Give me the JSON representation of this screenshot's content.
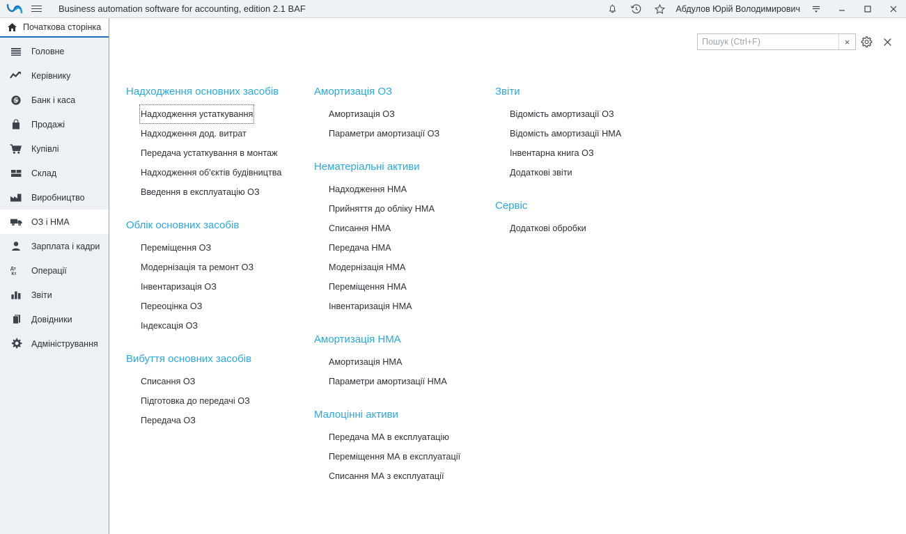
{
  "titlebar": {
    "logo_icon": "ba-logo-icon",
    "menu_icon": "hamburger-menu-icon",
    "app_title": "Business automation software for accounting, edition 2.1 BAF",
    "notifications_icon": "bell-icon",
    "history_icon": "history-clock-icon",
    "favorites_icon": "star-icon",
    "user_name": "Абдулов Юрій Володимирович",
    "filter_icon": "filter-lines-icon",
    "minimize_icon": "minimize-icon",
    "maximize_icon": "maximize-icon",
    "close_icon": "close-icon"
  },
  "sidebar": {
    "home_tab": {
      "label": "Початкова сторінка",
      "icon": "home-icon"
    },
    "items": [
      {
        "label": "Головне",
        "icon": "list-lines-icon",
        "active": false
      },
      {
        "label": "Керівнику",
        "icon": "trend-arrow-icon",
        "active": false
      },
      {
        "label": "Банк і каса",
        "icon": "currency-circle-icon",
        "active": false
      },
      {
        "label": "Продажі",
        "icon": "shopping-bag-icon",
        "active": false
      },
      {
        "label": "Купівлі",
        "icon": "shopping-cart-icon",
        "active": false
      },
      {
        "label": "Склад",
        "icon": "grid-blocks-icon",
        "active": false
      },
      {
        "label": "Виробництво",
        "icon": "factory-icon",
        "active": false
      },
      {
        "label": "ОЗ і НМА",
        "icon": "truck-icon",
        "active": true
      },
      {
        "label": "Зарплата і кадри",
        "icon": "person-icon",
        "active": false
      },
      {
        "label": "Операції",
        "icon": "debit-credit-icon",
        "active": false
      },
      {
        "label": "Звіти",
        "icon": "bar-chart-icon",
        "active": false
      },
      {
        "label": "Довідники",
        "icon": "books-stack-icon",
        "active": false
      },
      {
        "label": "Адміністрування",
        "icon": "gear-icon",
        "active": false
      }
    ]
  },
  "search": {
    "value": "",
    "placeholder": "Пошук (Ctrl+F)",
    "clear_label": "×",
    "settings_icon": "gear-icon",
    "close_icon": "close-icon"
  },
  "columns": [
    {
      "groups": [
        {
          "title": "Надходження основних засобів",
          "items": [
            {
              "label": "Надходження устаткування",
              "focused": true
            },
            {
              "label": "Надходження дод. витрат",
              "focused": false
            },
            {
              "label": "Передача устаткування в монтаж",
              "focused": false
            },
            {
              "label": "Надходження об'єктів будівництва",
              "focused": false
            },
            {
              "label": "Введення в експлуатацію ОЗ",
              "focused": false
            }
          ]
        },
        {
          "title": "Облік основних засобів",
          "items": [
            {
              "label": "Переміщення ОЗ",
              "focused": false
            },
            {
              "label": "Модернізація та ремонт ОЗ",
              "focused": false
            },
            {
              "label": "Інвентаризація ОЗ",
              "focused": false
            },
            {
              "label": "Переоцінка ОЗ",
              "focused": false
            },
            {
              "label": "Індексація ОЗ",
              "focused": false
            }
          ]
        },
        {
          "title": "Вибуття основних засобів",
          "items": [
            {
              "label": "Списання ОЗ",
              "focused": false
            },
            {
              "label": "Підготовка до передачі ОЗ",
              "focused": false
            },
            {
              "label": "Передача ОЗ",
              "focused": false
            }
          ]
        }
      ]
    },
    {
      "groups": [
        {
          "title": "Амортизація ОЗ",
          "items": [
            {
              "label": "Амортизація ОЗ",
              "focused": false
            },
            {
              "label": "Параметри амортизації ОЗ",
              "focused": false
            }
          ]
        },
        {
          "title": "Нематеріальні активи",
          "items": [
            {
              "label": "Надходження НМА",
              "focused": false
            },
            {
              "label": "Прийняття до обліку НМА",
              "focused": false
            },
            {
              "label": "Списання НМА",
              "focused": false
            },
            {
              "label": "Передача НМА",
              "focused": false
            },
            {
              "label": "Модернізація НМА",
              "focused": false
            },
            {
              "label": "Переміщення НМА",
              "focused": false
            },
            {
              "label": "Інвентаризація НМА",
              "focused": false
            }
          ]
        },
        {
          "title": "Амортизація НМА",
          "items": [
            {
              "label": "Амортизація НМА",
              "focused": false
            },
            {
              "label": "Параметри амортизації НМА",
              "focused": false
            }
          ]
        },
        {
          "title": "Малоцінні активи",
          "items": [
            {
              "label": "Передача МА в експлуатацію",
              "focused": false
            },
            {
              "label": "Переміщення МА в експлуатації",
              "focused": false
            },
            {
              "label": "Списання МА з експлуатації",
              "focused": false
            }
          ]
        }
      ]
    },
    {
      "groups": [
        {
          "title": "Звіти",
          "items": [
            {
              "label": "Відомість амортизації ОЗ",
              "focused": false
            },
            {
              "label": "Відомість амортизації НМА",
              "focused": false
            },
            {
              "label": "Інвентарна книга ОЗ",
              "focused": false
            },
            {
              "label": "Додаткові звіти",
              "focused": false
            }
          ]
        },
        {
          "title": "Сервіс",
          "items": [
            {
              "label": "Додаткові обробки",
              "focused": false
            }
          ]
        }
      ]
    }
  ],
  "colors": {
    "accent_blue": "#2aa8e0",
    "tab_underline": "#1d6fb8",
    "sidebar_bg": "#edf1f5",
    "titlebar_bg": "#eef2f5",
    "text": "#2b3136"
  }
}
